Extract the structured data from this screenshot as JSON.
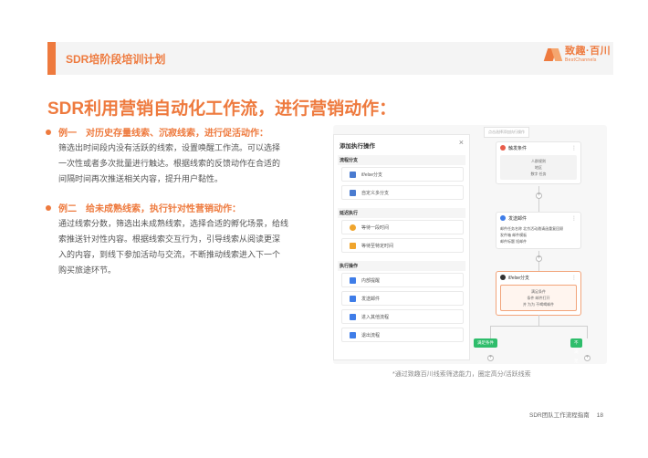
{
  "header": {
    "title": "SDR培阶段培训计划"
  },
  "logo": {
    "cn": "致趣·百川",
    "en": "BestChannels",
    "accent": "#ee7a3e"
  },
  "main_title": "SDR利用营销自动化工作流，进行营销动作：",
  "examples": [
    {
      "tag": "例一",
      "title": "对历史存量线索、沉寂线索，进行促活动作：",
      "lines": [
        "筛选出时间段内没有活跃的线索，设置唤醒工作流。可以选择",
        "一次性或者多次批量进行触达。根据线索的反馈动作在合适的",
        "间隔时间再次推送相关内容，提升用户黏性。"
      ]
    },
    {
      "tag": "例二",
      "title": "给未成熟线索，执行针对性营销动作：",
      "lines": [
        "通过线索分数，筛选出未成熟线索，选择合适的孵化场景，给线",
        "索推送针对性内容。根据线索交互行为，引导线索从阅读更深",
        "入的内容，到线下参加活动与交流，不断推动线索进入下一个",
        "购买旅途环节。"
      ]
    }
  ],
  "screenshot": {
    "panel_title": "添加执行操作",
    "close": "×",
    "groups": [
      {
        "label": "流程分支",
        "items": [
          {
            "label": "if/else分支",
            "color": "#4a7bd0"
          },
          {
            "label": "自定义多分支",
            "color": "#4a7bd0"
          }
        ]
      },
      {
        "label": "延迟执行",
        "items": [
          {
            "label": "等待一段时间",
            "color": "#f0a52d"
          },
          {
            "label": "等待至特定时间",
            "color": "#f0a52d"
          }
        ]
      },
      {
        "label": "执行操作",
        "items": [
          {
            "label": "内部提醒",
            "color": "#3f7de8"
          },
          {
            "label": "发送邮件",
            "color": "#3f7de8"
          },
          {
            "label": "进入其他流程",
            "color": "#3f7de8"
          },
          {
            "label": "退出流程",
            "color": "#3f7de8"
          }
        ]
      }
    ],
    "tip": "点击选择添加执行操作",
    "nodes": [
      {
        "title": "触发条件",
        "body": [
          "人群规则",
          "地区",
          "数字 任务"
        ]
      },
      {
        "title": "发送邮件",
        "body": [
          "邮件任务名称 北京活动邀请函重复回顾",
          "发件箱 邮件模板",
          "邮件标题 短邮件"
        ]
      },
      {
        "title": "if/else分支",
        "body": [
          "满足条件",
          "条件 邮件打开",
          "并 为为 不喝喝邮件"
        ]
      }
    ],
    "branches": [
      "满足条件",
      "不满足条件"
    ],
    "plus": "+"
  },
  "caption": "*通过致趣百川线索筛选能力，圈定高分/活跃线索",
  "footer": {
    "text": "SDR团队工作流程指南",
    "page": "18"
  }
}
